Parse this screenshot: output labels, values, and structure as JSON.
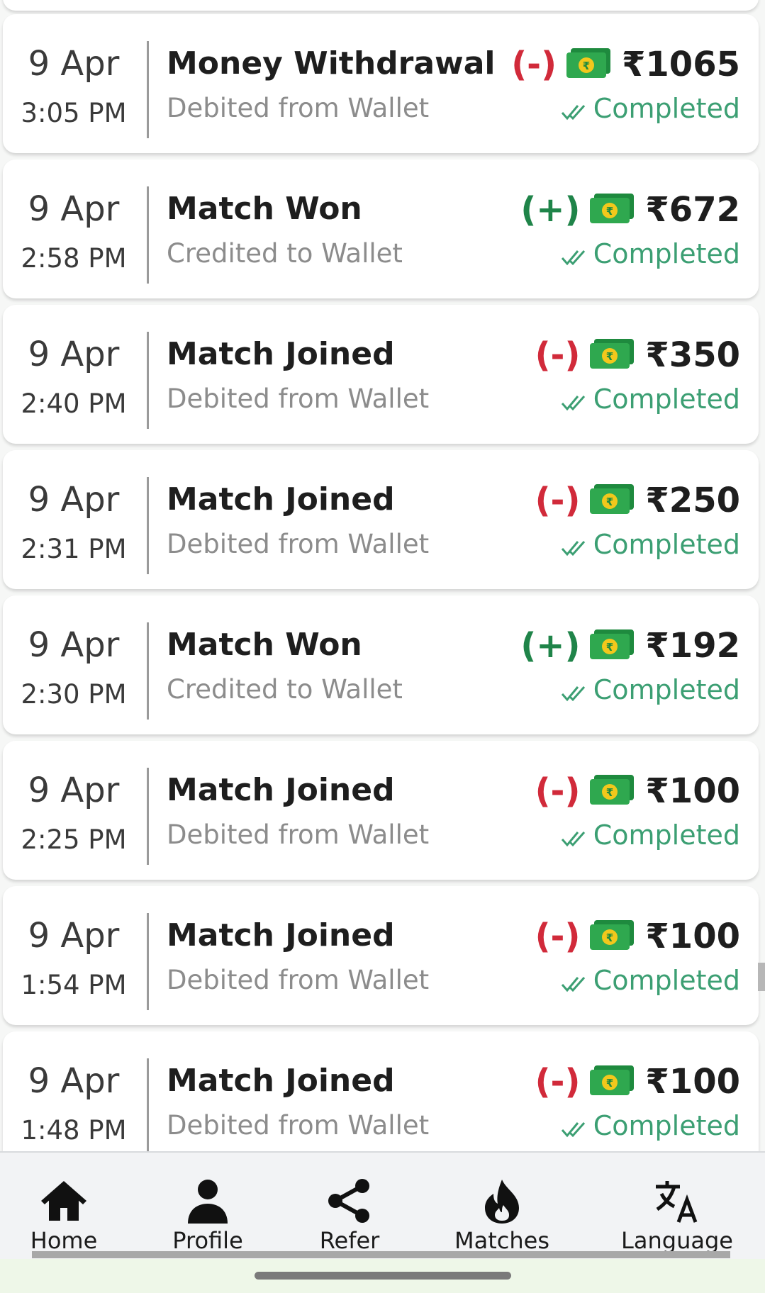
{
  "transactions": [
    {
      "date": "9 Apr",
      "time": "3:05 PM",
      "title": "Money Withdrawal",
      "subtitle": "Debited from Wallet",
      "sign": "(-)",
      "type": "debit",
      "amount": "₹1065",
      "status": "Completed"
    },
    {
      "date": "9 Apr",
      "time": "2:58 PM",
      "title": "Match Won",
      "subtitle": "Credited to Wallet",
      "sign": "(+)",
      "type": "credit",
      "amount": "₹672",
      "status": "Completed"
    },
    {
      "date": "9 Apr",
      "time": "2:40 PM",
      "title": "Match Joined",
      "subtitle": "Debited from Wallet",
      "sign": "(-)",
      "type": "debit",
      "amount": "₹350",
      "status": "Completed"
    },
    {
      "date": "9 Apr",
      "time": "2:31 PM",
      "title": "Match Joined",
      "subtitle": "Debited from Wallet",
      "sign": "(-)",
      "type": "debit",
      "amount": "₹250",
      "status": "Completed"
    },
    {
      "date": "9 Apr",
      "time": "2:30 PM",
      "title": "Match Won",
      "subtitle": "Credited to Wallet",
      "sign": "(+)",
      "type": "credit",
      "amount": "₹192",
      "status": "Completed"
    },
    {
      "date": "9 Apr",
      "time": "2:25 PM",
      "title": "Match Joined",
      "subtitle": "Debited from Wallet",
      "sign": "(-)",
      "type": "debit",
      "amount": "₹100",
      "status": "Completed"
    },
    {
      "date": "9 Apr",
      "time": "1:54 PM",
      "title": "Match Joined",
      "subtitle": "Debited from Wallet",
      "sign": "(-)",
      "type": "debit",
      "amount": "₹100",
      "status": "Completed"
    },
    {
      "date": "9 Apr",
      "time": "1:48 PM",
      "title": "Match Joined",
      "subtitle": "Debited from Wallet",
      "sign": "(-)",
      "type": "debit",
      "amount": "₹100",
      "status": "Completed"
    }
  ],
  "nav": {
    "items": [
      {
        "label": "Home",
        "icon": "home-icon"
      },
      {
        "label": "Profile",
        "icon": "person-icon"
      },
      {
        "label": "Refer",
        "icon": "share-icon"
      },
      {
        "label": "Matches",
        "icon": "fire-icon"
      },
      {
        "label": "Language",
        "icon": "translate-icon"
      }
    ]
  },
  "colors": {
    "debit": "#d12a3a",
    "credit": "#1f8449",
    "status": "#3c9f73",
    "cash": "#2fa84f"
  }
}
